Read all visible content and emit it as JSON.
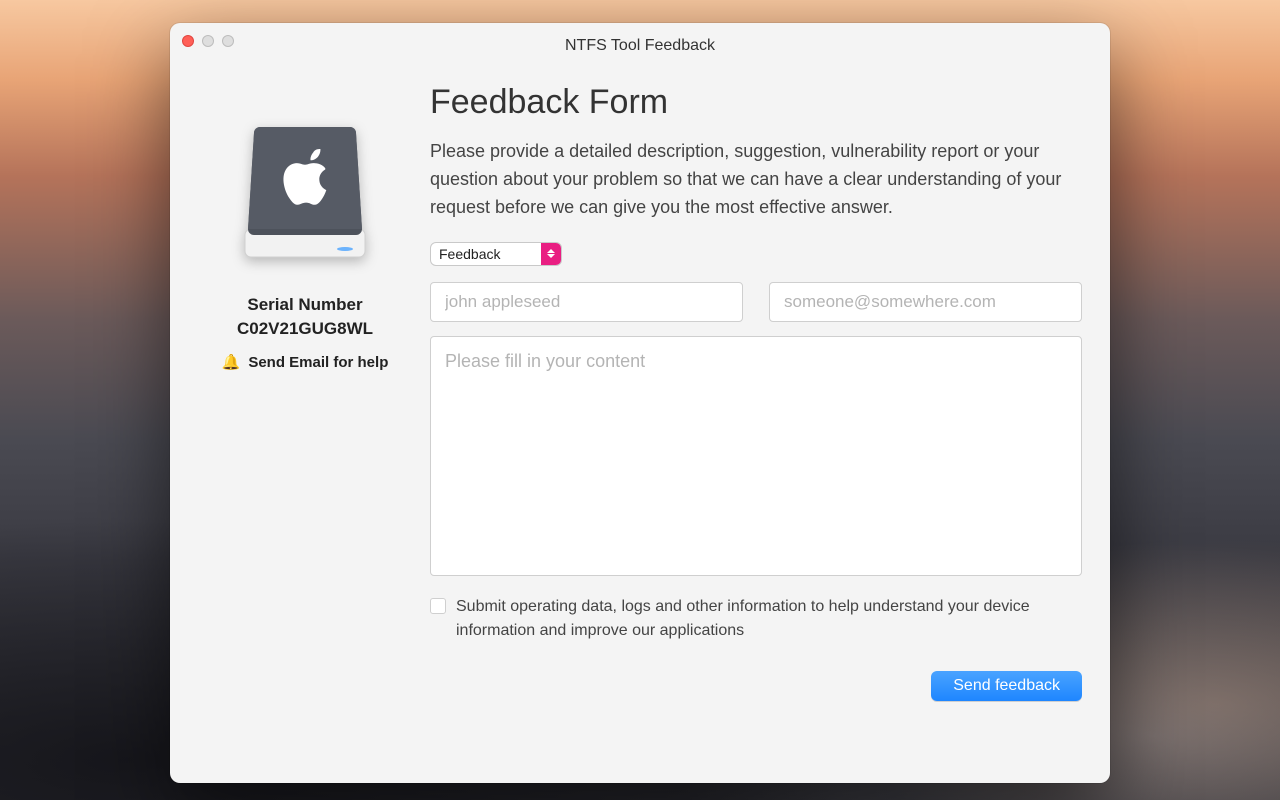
{
  "window": {
    "title": "NTFS Tool Feedback"
  },
  "sidebar": {
    "serial_label": "Serial Number",
    "serial_value": "C02V21GUG8WL",
    "help_link": "Send Email for help",
    "bell_icon": "🔔"
  },
  "form": {
    "heading": "Feedback Form",
    "description": "Please provide a detailed description, suggestion, vulnerability report or your question about your problem so that we can have a clear understanding of your request before we can give you the most effective answer.",
    "type_select": {
      "value": "Feedback"
    },
    "name_input": {
      "placeholder": "john appleseed",
      "value": ""
    },
    "email_input": {
      "placeholder": "someone@somewhere.com",
      "value": ""
    },
    "content_textarea": {
      "placeholder": "Please fill in your content",
      "value": ""
    },
    "submit_data_checkbox": {
      "checked": false,
      "label": "Submit operating data, logs and other information to help understand your device information and improve our applications"
    },
    "send_button": "Send feedback"
  }
}
